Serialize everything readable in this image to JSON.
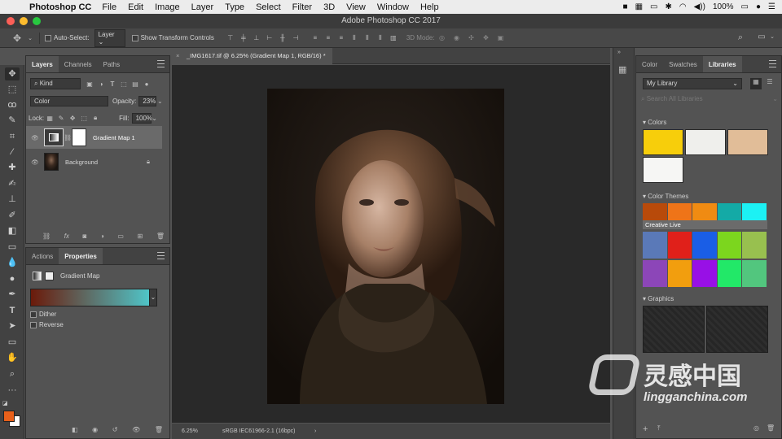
{
  "menubar": {
    "app_name": "Photoshop CC",
    "items": [
      "File",
      "Edit",
      "Image",
      "Layer",
      "Type",
      "Select",
      "Filter",
      "3D",
      "View",
      "Window",
      "Help"
    ],
    "battery": "100%",
    "wifi_icon": "wifi-icon"
  },
  "window": {
    "title": "Adobe Photoshop CC 2017"
  },
  "options": {
    "auto_select": "Auto-Select:",
    "auto_select_target": "Layer",
    "show_transform": "Show Transform Controls",
    "mode_3d": "3D Mode:"
  },
  "layers_panel": {
    "tabs": [
      "Layers",
      "Channels",
      "Paths"
    ],
    "filter_kind": "Kind",
    "blend_mode": "Color",
    "opacity_label": "Opacity:",
    "opacity_value": "23%",
    "lock_label": "Lock:",
    "fill_label": "Fill:",
    "fill_value": "100%",
    "layers": [
      {
        "name": "Gradient Map 1"
      },
      {
        "name": "Background"
      }
    ]
  },
  "properties_panel": {
    "tabs": [
      "Actions",
      "Properties"
    ],
    "title": "Gradient Map",
    "dither": "Dither",
    "reverse": "Reverse",
    "gradient_start": "#6b1a0a",
    "gradient_end": "#4fc8cc"
  },
  "document": {
    "tab_title": "_IMG1617.tif @ 6.25% (Gradient Map 1, RGB/16) *",
    "zoom": "6.25%",
    "profile": "sRGB IEC61966-2.1 (16bpc)"
  },
  "libraries_panel": {
    "tabs": [
      "Color",
      "Swatches",
      "Libraries"
    ],
    "library_name": "My Library",
    "search_placeholder": "Search All Libraries",
    "colors_label": "Colors",
    "colors": [
      "#f7ce0b",
      "#efefec",
      "#e1bd98",
      "#f6f6f4"
    ],
    "themes_label": "Color Themes",
    "themes": [
      {
        "name": "Creative Live",
        "colors": [
          "#b84a0a",
          "#ef7418",
          "#f08b12",
          "#14aaa6",
          "#1cf1f4"
        ]
      },
      {
        "name": "",
        "colors": [
          "#5a79b8",
          "#e0201a",
          "#1a5ee6",
          "#7cd61e",
          "#98c04f"
        ]
      },
      {
        "name": "",
        "colors": [
          "#8c46b8",
          "#f29e0e",
          "#9810e6",
          "#22e868",
          "#52c67e"
        ]
      }
    ],
    "graphics_label": "Graphics"
  },
  "watermark": {
    "brand": "灵感中国",
    "url": "lingganchina.com"
  },
  "colors": {
    "foreground": "#e8601a",
    "background": "#ffffff"
  }
}
